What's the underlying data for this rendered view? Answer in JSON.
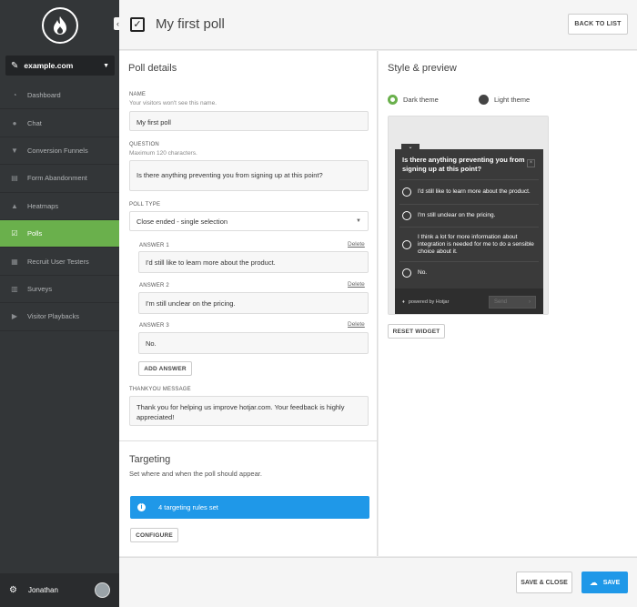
{
  "sidebar": {
    "site": "example.com",
    "collapse_glyph": "‹",
    "items": [
      {
        "label": "Dashboard",
        "icon": "dashboard-icon",
        "glyph": "◔"
      },
      {
        "label": "Chat",
        "icon": "chat-icon",
        "glyph": "●"
      },
      {
        "label": "Conversion Funnels",
        "icon": "funnel-icon",
        "glyph": "▼"
      },
      {
        "label": "Form Abandonment",
        "icon": "form-icon",
        "glyph": "▤"
      },
      {
        "label": "Heatmaps",
        "icon": "heatmap-icon",
        "glyph": "▲"
      },
      {
        "label": "Polls",
        "icon": "poll-icon",
        "glyph": "☑"
      },
      {
        "label": "Recruit User Testers",
        "icon": "recruit-icon",
        "glyph": "▦"
      },
      {
        "label": "Surveys",
        "icon": "survey-icon",
        "glyph": "▥"
      },
      {
        "label": "Visitor Playbacks",
        "icon": "play-icon",
        "glyph": "▶"
      }
    ],
    "active_index": 5,
    "user_name": "Jonathan"
  },
  "header": {
    "title": "My first poll",
    "back_label": "BACK TO LIST"
  },
  "poll_details": {
    "section_title": "Poll details",
    "name_label": "NAME",
    "name_hint": "Your visitors won't see this name.",
    "name_value": "My first poll",
    "question_label": "QUESTION",
    "question_hint": "Maximum 120 characters.",
    "question_value": "Is there anything preventing you from signing up at this point?",
    "poll_type_label": "POLL TYPE",
    "poll_type_value": "Close ended - single selection",
    "delete_label": "Delete",
    "answers": [
      {
        "label": "ANSWER 1",
        "value": "I'd still like to learn more about the product."
      },
      {
        "label": "ANSWER 2",
        "value": "I'm still unclear on the pricing."
      },
      {
        "label": "ANSWER 3",
        "value": "No."
      }
    ],
    "add_answer_label": "ADD ANSWER",
    "thankyou_label": "THANKYOU MESSAGE",
    "thankyou_value": "Thank you for helping us improve hotjar.com. Your feedback is highly appreciated!"
  },
  "targeting": {
    "section_title": "Targeting",
    "description": "Set where and when the poll should appear.",
    "rules_text": "4 targeting rules set",
    "configure_label": "CONFIGURE"
  },
  "style_preview": {
    "section_title": "Style & preview",
    "dark_theme_label": "Dark theme",
    "light_theme_label": "Light theme",
    "selected_theme": "dark",
    "accent_color": "#6ab04c",
    "widget": {
      "question": "Is there anything preventing you from signing up at this point?",
      "answers": [
        "I'd still like to learn more about the product.",
        "I'm still unclear on the pricing.",
        "I think a lot for more information about integration is needed for me to do a sensible choice about it.",
        "No."
      ],
      "powered_by": "powered by Hotjar",
      "send_label": "Send"
    },
    "reset_label": "RESET WIDGET"
  },
  "footer": {
    "save_close_label": "SAVE & CLOSE",
    "save_label": "SAVE",
    "primary_color": "#1f98e8"
  }
}
